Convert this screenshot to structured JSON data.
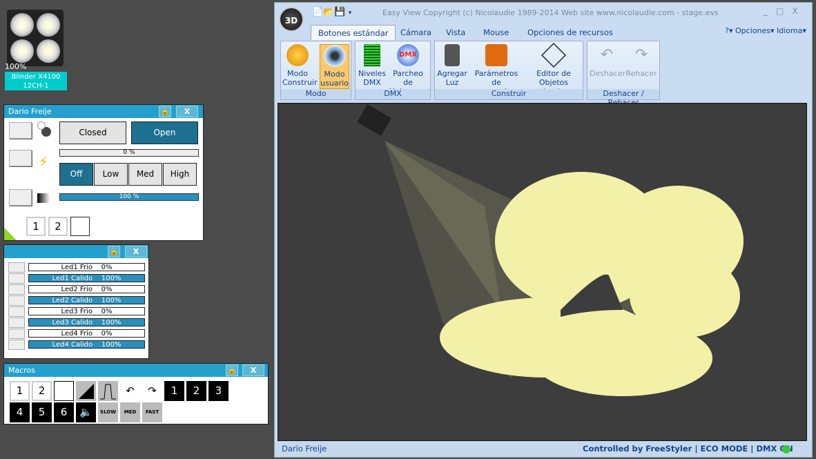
{
  "fixture": {
    "percent": "100%",
    "name": "Blinder X4100",
    "mode": "12CH-1"
  },
  "dario_panel": {
    "title": "Dario Freije",
    "shutter": {
      "closed": "Closed",
      "open": "Open"
    },
    "strobe_percent": "0 %",
    "strobe_buttons": [
      "Off",
      "Low",
      "Med",
      "High"
    ],
    "dimmer_percent": "100 %",
    "presets": [
      "1",
      "2",
      ""
    ]
  },
  "leds_panel": {
    "items": [
      {
        "label": "Led1 Frio",
        "value": "0%",
        "level": 0
      },
      {
        "label": "Led1 Calido",
        "value": "100%",
        "level": 100
      },
      {
        "label": "Led2 Frio",
        "value": "0%",
        "level": 0
      },
      {
        "label": "Led2 Calido",
        "value": "100%",
        "level": 100
      },
      {
        "label": "Led3 Frio",
        "value": "0%",
        "level": 0
      },
      {
        "label": "Led3 Calido",
        "value": "100%",
        "level": 100
      },
      {
        "label": "Led4 Frio",
        "value": "0%",
        "level": 0
      },
      {
        "label": "Led4 Calido",
        "value": "100%",
        "level": 100
      }
    ]
  },
  "macros_panel": {
    "title": "Macros",
    "row1": [
      "1",
      "2",
      ""
    ],
    "black1": [
      "1",
      "2",
      "3"
    ],
    "black2": [
      "4",
      "5",
      "6"
    ],
    "speed": [
      "SLOW",
      "MED",
      "FAST"
    ]
  },
  "window": {
    "logo": "3D",
    "title": "Easy View   Copyright (c) Nicolaudie 1989-2014    Web site www.nicolaudie.com - stage.evs",
    "tabs": [
      "Botones estándar",
      "Cámara",
      "Vista",
      "Mouse",
      "Opciones de recursos"
    ],
    "right_menu": [
      "?",
      "Opciones",
      "Idioma"
    ],
    "groups": [
      {
        "label": "Modo",
        "buttons": [
          "Modo Construir",
          "Modo usuario"
        ]
      },
      {
        "label": "DMX",
        "buttons": [
          "Niveles DMX",
          "Parcheo de Universos"
        ]
      },
      {
        "label": "Construir",
        "buttons": [
          "Agregar Luz",
          "Parámetros de escenario...",
          "Editor de Objetos simples"
        ]
      },
      {
        "label": "Deshacer / Rehacer",
        "buttons": [
          "Deshacer",
          "Rehacer"
        ]
      }
    ],
    "status": {
      "left": "Dario Freije",
      "controlled": "Controlled by FreeStyler",
      "eco": "ECO MODE",
      "dmx": "DMX ON"
    }
  },
  "colors": {
    "accent": "#25a0cc",
    "active": "#1e7090",
    "light": "#f3f0a8"
  }
}
